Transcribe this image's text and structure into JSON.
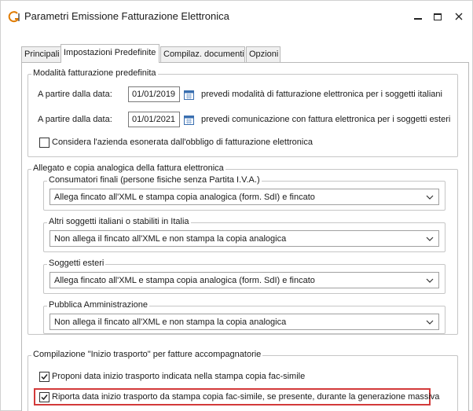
{
  "window": {
    "title": "Parametri Emissione Fatturazione Elettronica",
    "minimize_label": "–",
    "close_label": "×"
  },
  "tabs": [
    {
      "label": "Principali"
    },
    {
      "label": "Impostazioni Predefinite"
    },
    {
      "label": "Compilaz. documenti"
    },
    {
      "label": "Opzioni"
    }
  ],
  "modalita": {
    "title": "Modalità fatturazione predefinita",
    "row1": {
      "label": "A partire dalla data:",
      "date": "01/01/2019",
      "text": "prevedi modalità di fatturazione elettronica per i soggetti italiani"
    },
    "row2": {
      "label": "A partire dalla data:",
      "date": "01/01/2021",
      "text": "prevedi comunicazione con fattura elettronica per i soggetti esteri"
    },
    "esonerata_label": "Considera l'azienda esonerata dall'obbligo di fatturazione elettronica",
    "esonerata_checked": false
  },
  "allegato": {
    "title": "Allegato e copia analogica della fattura elettronica",
    "groups": [
      {
        "title": "Consumatori finali (persone fisiche senza Partita I.V.A.)",
        "value": "Allega fincato all'XML e stampa copia analogica (form. SdI) e fincato"
      },
      {
        "title": "Altri soggetti italiani o stabiliti in Italia",
        "value": "Non allega il fincato all'XML e non stampa la copia analogica"
      },
      {
        "title": "Soggetti esteri",
        "value": "Allega fincato all'XML e stampa copia analogica (form. SdI) e fincato"
      },
      {
        "title": "Pubblica Amministrazione",
        "value": "Non allega il fincato all'XML e non stampa la copia analogica"
      }
    ]
  },
  "trasporto": {
    "title": "Compilazione \"Inizio trasporto\" per fatture accompagnatorie",
    "opt1": {
      "label": "Proponi data inizio trasporto indicata nella stampa copia fac-simile",
      "checked": true
    },
    "opt2": {
      "label": "Riporta data inizio trasporto da stampa copia fac-simile, se presente, durante la generazione massiva",
      "checked": true
    }
  },
  "colors": {
    "highlight": "#d33a3a",
    "calendar": "#3a6fb0",
    "app_icon": "#e07b00"
  }
}
